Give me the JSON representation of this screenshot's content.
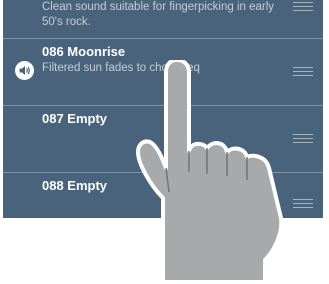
{
  "presets": [
    {
      "number_title": "",
      "description": "Clean sound suitable for fingerpicking in early 50's rock."
    },
    {
      "number_title": "086 Moonrise",
      "description": "Filtered sun fades to chorus eq",
      "playing": true
    },
    {
      "number_title": "087 Empty",
      "description": ""
    },
    {
      "number_title": "088 Empty",
      "description": ""
    }
  ],
  "icons": {
    "playing": "speaker-icon",
    "reorder": "drag-handle-icon",
    "gesture": "pointing-hand-icon"
  },
  "colors": {
    "list_background": "#4a637c",
    "divider": "#7e93a7",
    "title_text": "#ffffff",
    "description_text": "#c3ced9",
    "hand_fill": "#a8a9ab"
  }
}
